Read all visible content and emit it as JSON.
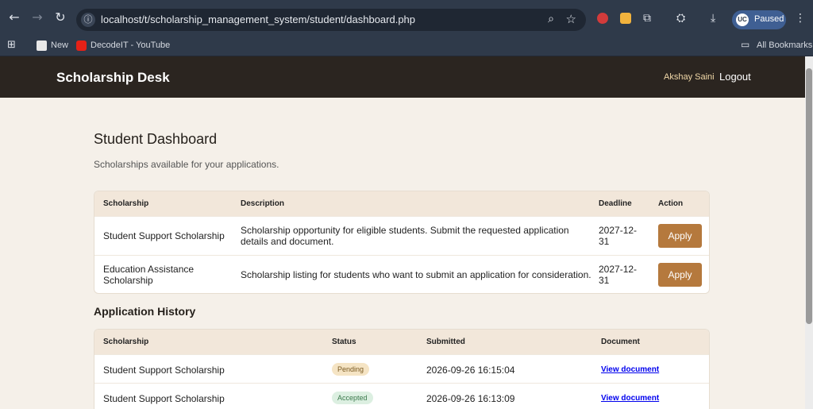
{
  "browser": {
    "url": "localhost/t/scholarship_management_system/student/dashboard.php",
    "profile_label": "Paused",
    "profile_initials": "UC",
    "bookmarks": [
      {
        "label": "New"
      },
      {
        "label": "DecodeIT - YouTube"
      }
    ],
    "all_bookmarks_label": "All Bookmarks"
  },
  "header": {
    "brand": "Scholarship Desk",
    "user_name": "Akshay Saini",
    "logout_label": "Logout"
  },
  "dashboard": {
    "title": "Student Dashboard",
    "subtitle": "Scholarships available for your applications."
  },
  "scholarships_table": {
    "headers": [
      "Scholarship",
      "Description",
      "Deadline",
      "Action"
    ],
    "rows": [
      {
        "name_lines": [
          "Student Support Scholarship"
        ],
        "desc_lines": [
          "Scholarship opportunity for eligible students. Submit the requested application",
          "details and document."
        ],
        "deadline_lines": [
          "2027-12-",
          "31"
        ],
        "action": "Apply"
      },
      {
        "name_lines": [
          "Education Assistance",
          "Scholarship"
        ],
        "desc_lines": [
          "Scholarship listing for students who want to submit an application for consideration."
        ],
        "deadline_lines": [
          "2027-12-",
          "31"
        ],
        "action": "Apply"
      }
    ]
  },
  "history": {
    "title": "Application History",
    "headers": [
      "Scholarship",
      "Status",
      "Submitted",
      "Document"
    ],
    "rows": [
      {
        "scholarship": "Student Support Scholarship",
        "status": "Pending",
        "submitted": "2026-09-26 16:15:04",
        "document": "View document"
      },
      {
        "scholarship": "Student Support Scholarship",
        "status": "Accepted",
        "submitted": "2026-09-26 16:13:09",
        "document": "View document"
      }
    ]
  },
  "colors": {
    "header_bg": "#2b2520",
    "accent": "#b5793d",
    "page_bg": "#f5f0e9",
    "table_head_bg": "#f2e7da"
  }
}
